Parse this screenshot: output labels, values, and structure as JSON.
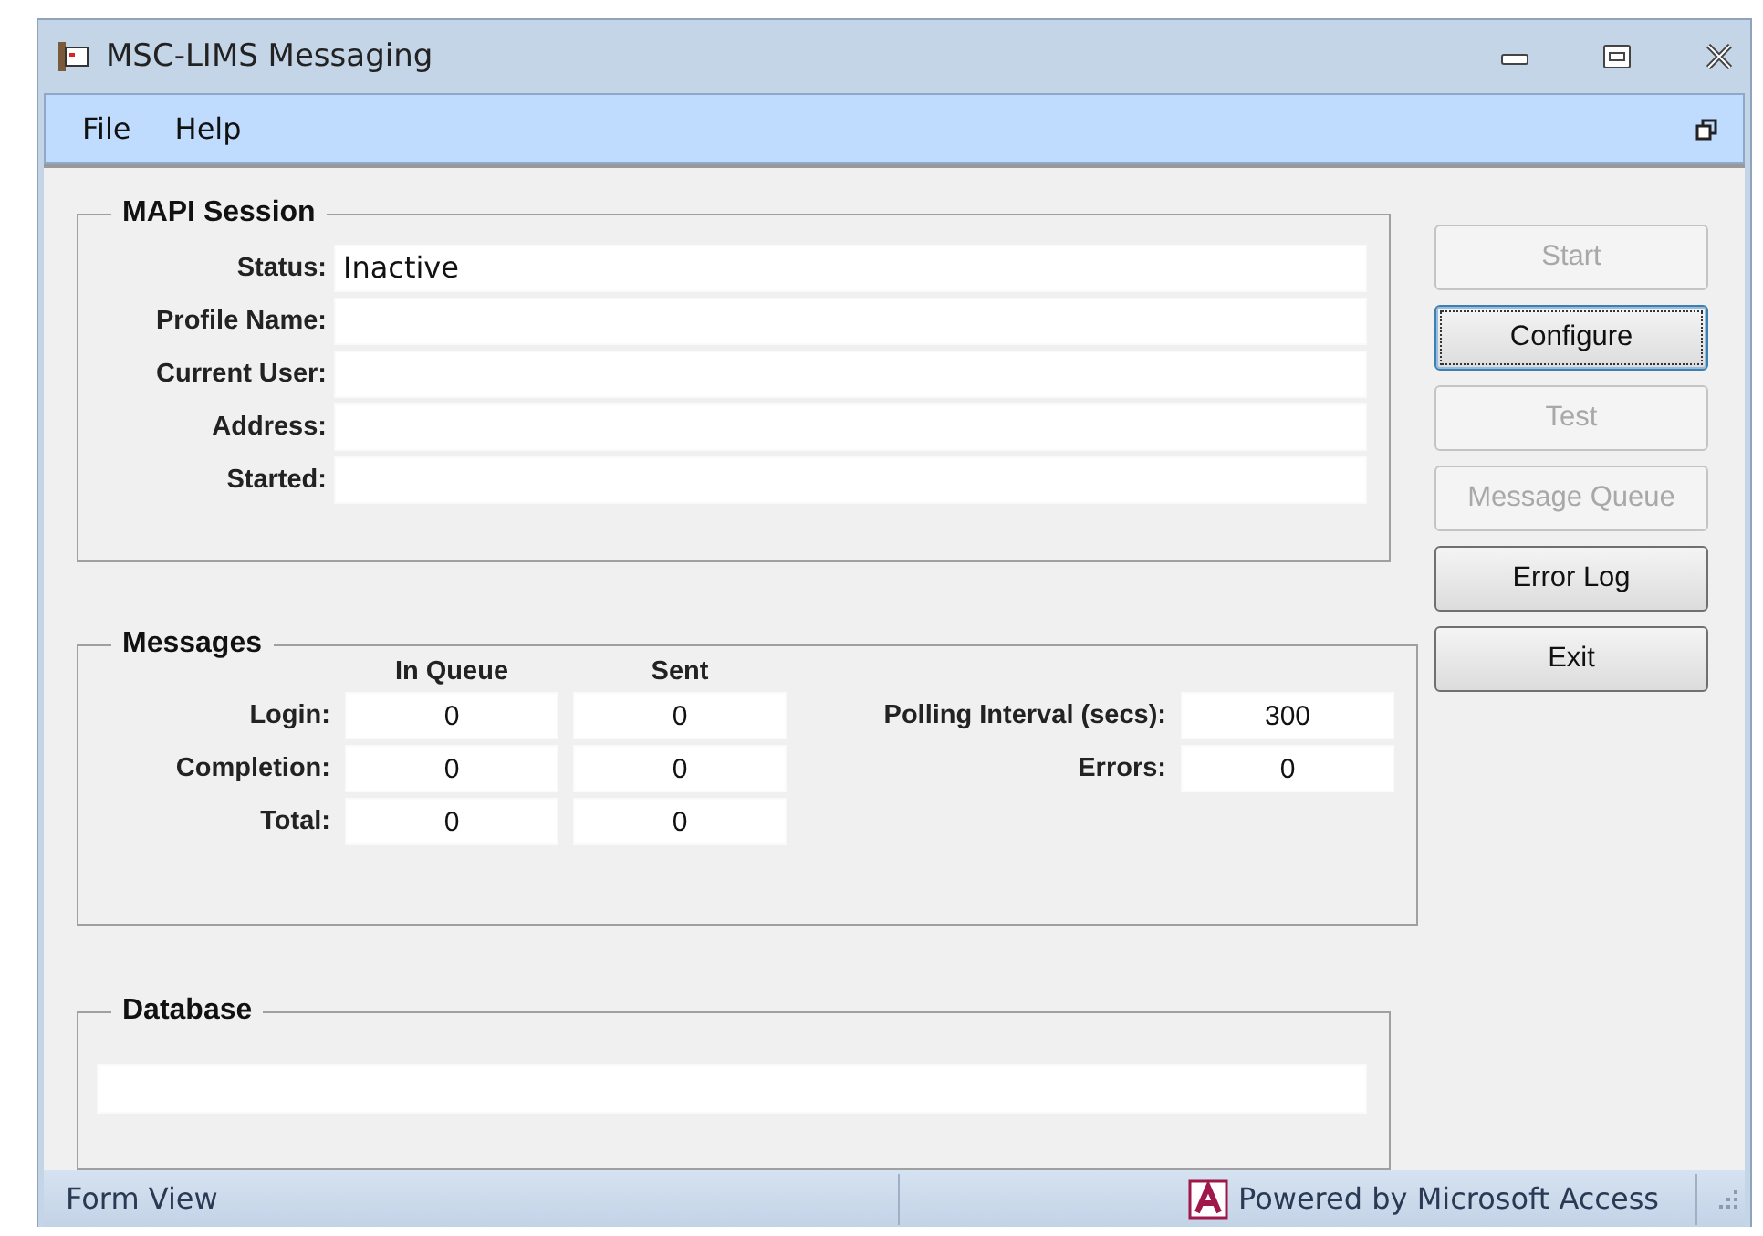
{
  "window": {
    "title": "MSC-LIMS Messaging"
  },
  "menu": [
    {
      "label": "File"
    },
    {
      "label": "Help"
    }
  ],
  "mapi_session": {
    "title": "MAPI Session",
    "fields": [
      {
        "label": "Status:",
        "value": "Inactive"
      },
      {
        "label": "Profile Name:"
      },
      {
        "label": "Current User:"
      },
      {
        "label": "Address:"
      },
      {
        "label": "Started:"
      }
    ]
  },
  "messages": {
    "title": "Messages",
    "columns": [
      "In Queue",
      "Sent"
    ],
    "rows": [
      {
        "label": "Login:",
        "values": [
          "0",
          "0"
        ]
      },
      {
        "label": "Completion:",
        "values": [
          "0",
          "0"
        ]
      },
      {
        "label": "Total:",
        "values": [
          "0",
          "0"
        ]
      }
    ],
    "side_fields": [
      {
        "label": "Polling Interval (secs):",
        "value": "300"
      },
      {
        "label": "Errors:",
        "value": "0"
      }
    ]
  },
  "database": {
    "title": "Database"
  },
  "buttons": [
    {
      "label": "Start",
      "disabled": true,
      "focused": false
    },
    {
      "label": "Configure",
      "disabled": false,
      "focused": true
    },
    {
      "label": "Test",
      "disabled": true,
      "focused": false
    },
    {
      "label": "Message Queue",
      "disabled": true,
      "focused": false
    },
    {
      "label": "Error Log",
      "disabled": false,
      "focused": false
    },
    {
      "label": "Exit",
      "disabled": false,
      "focused": false
    }
  ],
  "status_bar": {
    "view": "Form View",
    "powered_by": "Powered by Microsoft Access"
  }
}
